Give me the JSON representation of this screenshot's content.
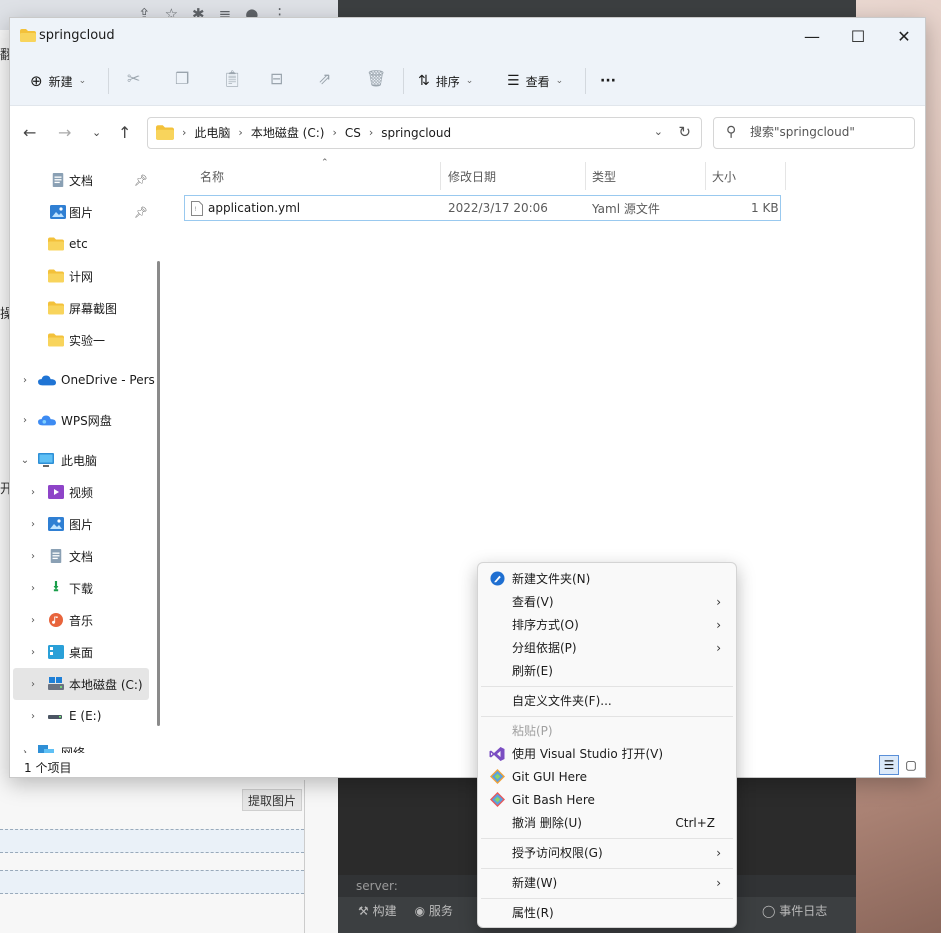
{
  "background": {
    "left_extract_button": "提取图片",
    "left_side_chars": [
      "翻",
      "操",
      "开"
    ],
    "ide_breadcrumb": "server:",
    "ide_tools": [
      "构建",
      "服务"
    ],
    "ide_event_log": "事件日志"
  },
  "window": {
    "title": "springcloud",
    "controls": {
      "minimize": "—",
      "maximize": "☐",
      "close": "✕"
    }
  },
  "toolbar": {
    "new_label": "新建",
    "sort_label": "排序",
    "view_label": "查看",
    "more_label": "···"
  },
  "address": {
    "crumbs": [
      "此电脑",
      "本地磁盘 (C:)",
      "CS",
      "springcloud"
    ]
  },
  "search": {
    "placeholder": "搜索\"springcloud\""
  },
  "nav": {
    "items": [
      {
        "label": "文档",
        "pinned": true
      },
      {
        "label": "图片",
        "pinned": true
      },
      {
        "label": "etc"
      },
      {
        "label": "计网"
      },
      {
        "label": "屏幕截图"
      },
      {
        "label": "实验一"
      },
      {
        "label": "OneDrive - Pers"
      },
      {
        "label": "WPS网盘"
      },
      {
        "label": "此电脑"
      },
      {
        "label": "视频"
      },
      {
        "label": "图片"
      },
      {
        "label": "文档"
      },
      {
        "label": "下载"
      },
      {
        "label": "音乐"
      },
      {
        "label": "桌面"
      },
      {
        "label": "本地磁盘 (C:)"
      },
      {
        "label": "E (E:)"
      },
      {
        "label": "网络"
      }
    ]
  },
  "columns": {
    "name": "名称",
    "modified": "修改日期",
    "type": "类型",
    "size": "大小"
  },
  "files": [
    {
      "name": "application.yml",
      "modified": "2022/3/17 20:06",
      "type": "Yaml 源文件",
      "size": "1 KB"
    }
  ],
  "status": {
    "count": "1 个项目"
  },
  "context_menu": {
    "new_folder": "新建文件夹(N)",
    "view": "查看(V)",
    "sort_by": "排序方式(O)",
    "group_by": "分组依据(P)",
    "refresh": "刷新(E)",
    "customize": "自定义文件夹(F)...",
    "paste": "粘贴(P)",
    "open_vs": "使用 Visual Studio 打开(V)",
    "git_gui": "Git GUI Here",
    "git_bash": "Git Bash Here",
    "undo_delete": "撤消 删除(U)",
    "undo_shortcut": "Ctrl+Z",
    "grant_access": "授予访问权限(G)",
    "new": "新建(W)",
    "properties": "属性(R)"
  }
}
